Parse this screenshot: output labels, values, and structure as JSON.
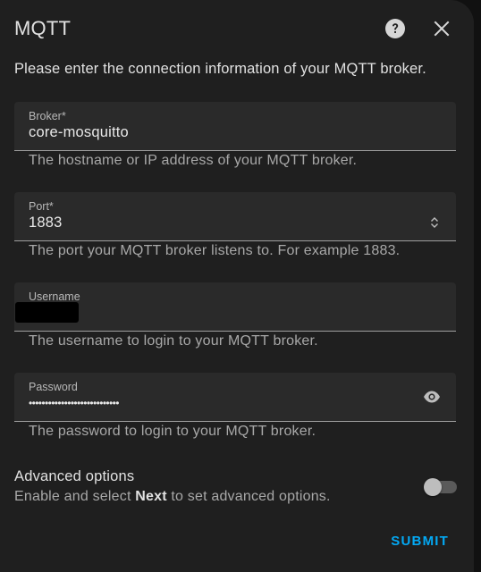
{
  "dialog": {
    "title": "MQTT",
    "description": "Please enter the connection information of your MQTT broker."
  },
  "fields": {
    "broker": {
      "label": "Broker*",
      "value": "core-mosquitto",
      "helper": "The hostname or IP address of your MQTT broker."
    },
    "port": {
      "label": "Port*",
      "value": "1883",
      "helper": "The port your MQTT broker listens to. For example 1883."
    },
    "username": {
      "label": "Username",
      "helper": "The username to login to your MQTT broker."
    },
    "password": {
      "label": "Password",
      "value": "••••••••••••••••••••••••••••",
      "helper": "The password to login to your MQTT broker."
    }
  },
  "advanced": {
    "title": "Advanced options",
    "desc_before": "Enable and select ",
    "desc_bold": "Next",
    "desc_after": " to set advanced options.",
    "enabled": false
  },
  "actions": {
    "submit_label": "SUBMIT"
  },
  "icons": {
    "help": "help-circle-icon",
    "close": "close-icon",
    "stepper": "stepper-icon",
    "eye": "eye-icon"
  },
  "colors": {
    "accent": "#03a9f4",
    "surface": "#1f1f1f",
    "field_background": "#2a2a2a"
  }
}
